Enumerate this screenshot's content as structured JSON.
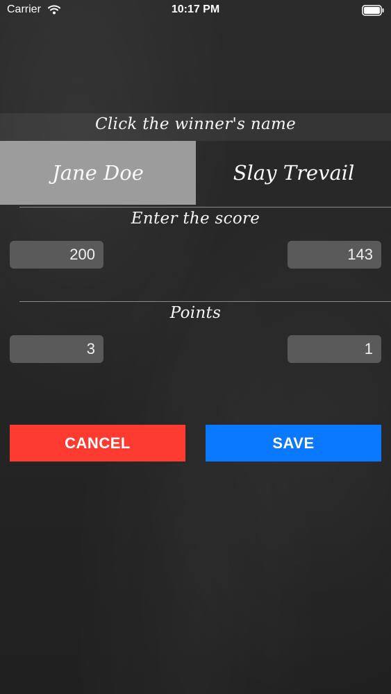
{
  "status_bar": {
    "carrier": "Carrier",
    "time": "10:17 PM",
    "wifi_icon": "wifi-icon",
    "battery_icon": "battery-icon"
  },
  "winner_section": {
    "title": "Click the winner's name",
    "players": [
      {
        "name": "Jane Doe",
        "selected": true
      },
      {
        "name": "Slay Trevail",
        "selected": false
      }
    ]
  },
  "score_section": {
    "title": "Enter the score",
    "left_value": "200",
    "right_value": "143"
  },
  "points_section": {
    "title": "Points",
    "left_value": "3",
    "right_value": "1"
  },
  "actions": {
    "cancel_label": "CANCEL",
    "save_label": "SAVE"
  },
  "colors": {
    "cancel_button": "#fe3b30",
    "save_button": "#0a79ff",
    "selected_player_bg": "#9c9c9c",
    "field_bg": "#5a5a5a",
    "background": "#262626"
  }
}
